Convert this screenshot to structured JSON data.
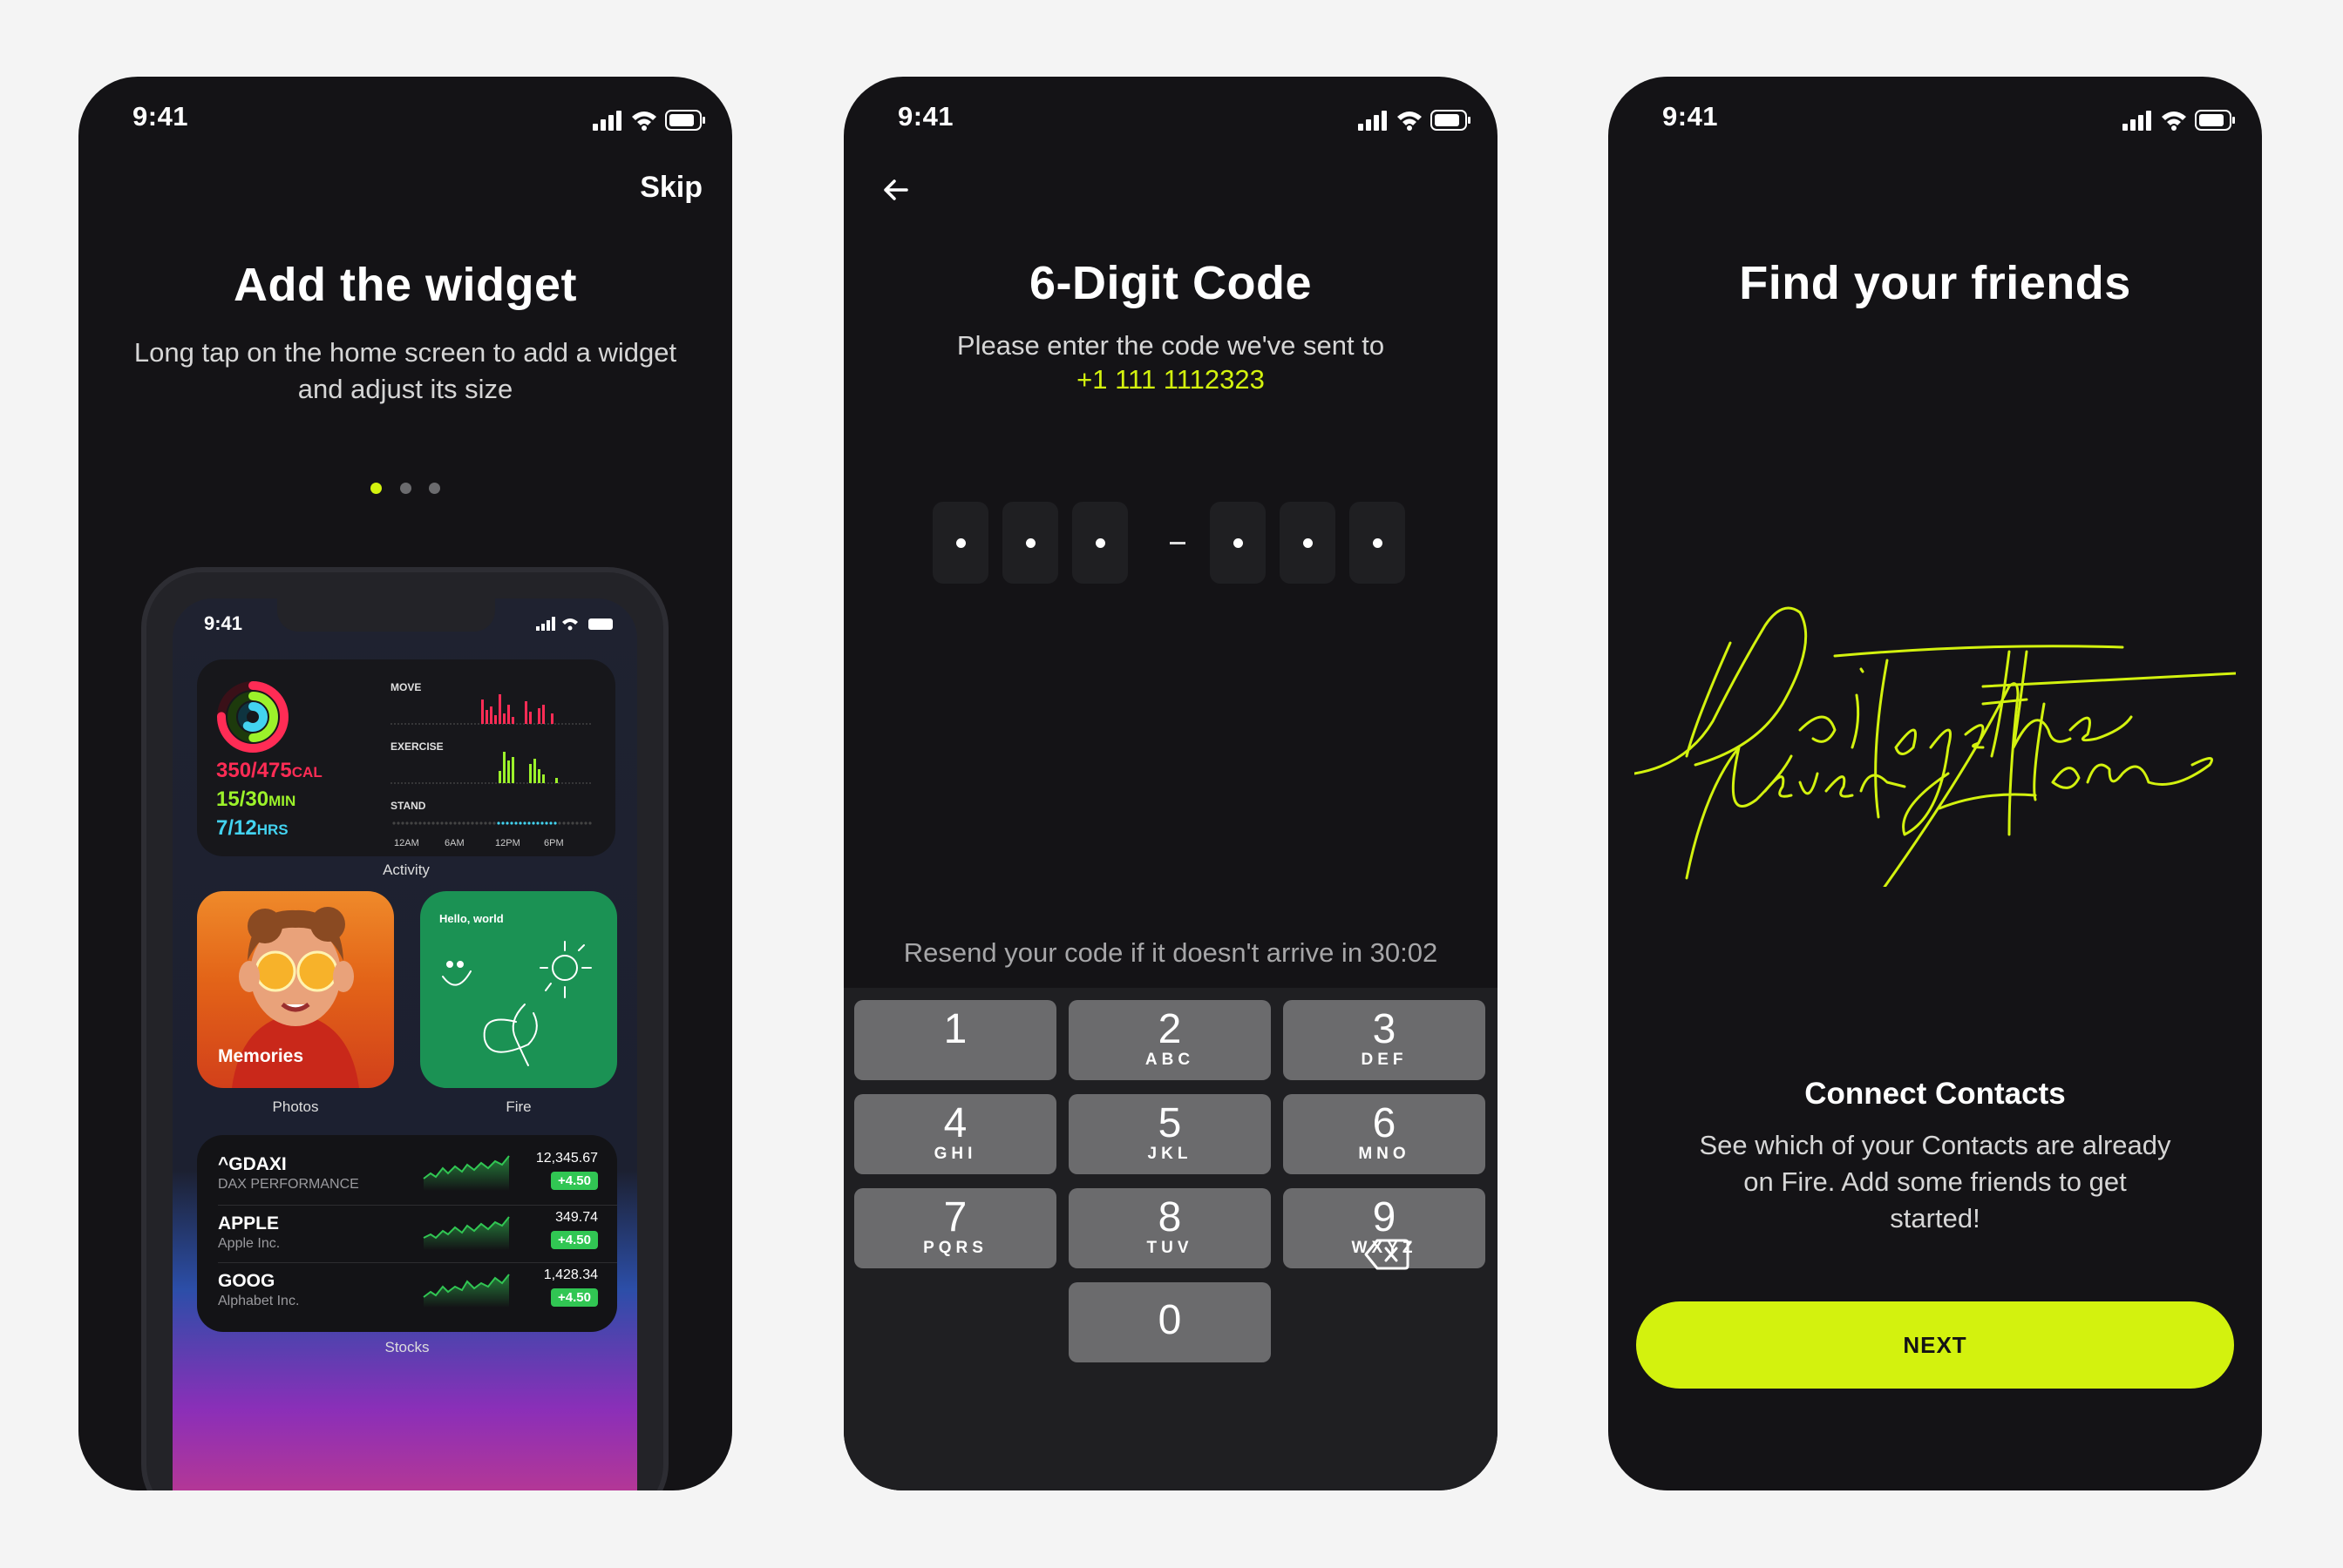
{
  "status_time": "9:41",
  "accent": "#d3f20e",
  "screen1": {
    "skip": "Skip",
    "title": "Add the widget",
    "subtitle": "Long tap on the home screen to add a widget and adjust its size",
    "page_indicator": {
      "current": 1,
      "total": 3
    },
    "mock": {
      "time": "9:41",
      "activity": {
        "move": "350/475",
        "move_unit": "CAL",
        "exercise": "15/30",
        "exercise_unit": "MIN",
        "stand": "7/12",
        "stand_unit": "HRS",
        "labels": {
          "move": "MOVE",
          "exercise": "EXERCISE",
          "stand": "STAND"
        },
        "times": [
          "12AM",
          "6AM",
          "12PM",
          "6PM"
        ],
        "widget_label": "Activity"
      },
      "photos": {
        "caption": "Memories",
        "widget_label": "Photos"
      },
      "fire": {
        "greeting": "Hello, world",
        "widget_label": "Fire"
      },
      "stocks": {
        "widget_label": "Stocks",
        "rows": [
          {
            "symbol": "^GDAXI",
            "name": "DAX PERFORMANCE",
            "value": "12,345.67",
            "change": "+4.50"
          },
          {
            "symbol": "APPLE",
            "name": "Apple Inc.",
            "value": "349.74",
            "change": "+4.50"
          },
          {
            "symbol": "GOOG",
            "name": "Alphabet Inc.",
            "value": "1,428.34",
            "change": "+4.50"
          }
        ]
      }
    }
  },
  "screen2": {
    "title": "6-Digit Code",
    "subtitle": "Please enter the code we've sent to",
    "phone": "+1 111 1112323",
    "resend": "Resend your code if it doesn't arrive in 30:02",
    "keys": [
      {
        "digit": "1",
        "letters": ""
      },
      {
        "digit": "2",
        "letters": "ABC"
      },
      {
        "digit": "3",
        "letters": "DEF"
      },
      {
        "digit": "4",
        "letters": "GHI"
      },
      {
        "digit": "5",
        "letters": "JKL"
      },
      {
        "digit": "6",
        "letters": "MNO"
      },
      {
        "digit": "7",
        "letters": "PQRS"
      },
      {
        "digit": "8",
        "letters": "TUV"
      },
      {
        "digit": "9",
        "letters": "WXYZ"
      },
      {
        "digit": "0",
        "letters": ""
      }
    ]
  },
  "screen3": {
    "title": "Find your friends",
    "script_text": "Do it together Never Alone",
    "connect_title": "Connect Contacts",
    "connect_text": "See which of your Contacts are already on Fire. Add some friends to get started!",
    "next": "NEXT"
  }
}
